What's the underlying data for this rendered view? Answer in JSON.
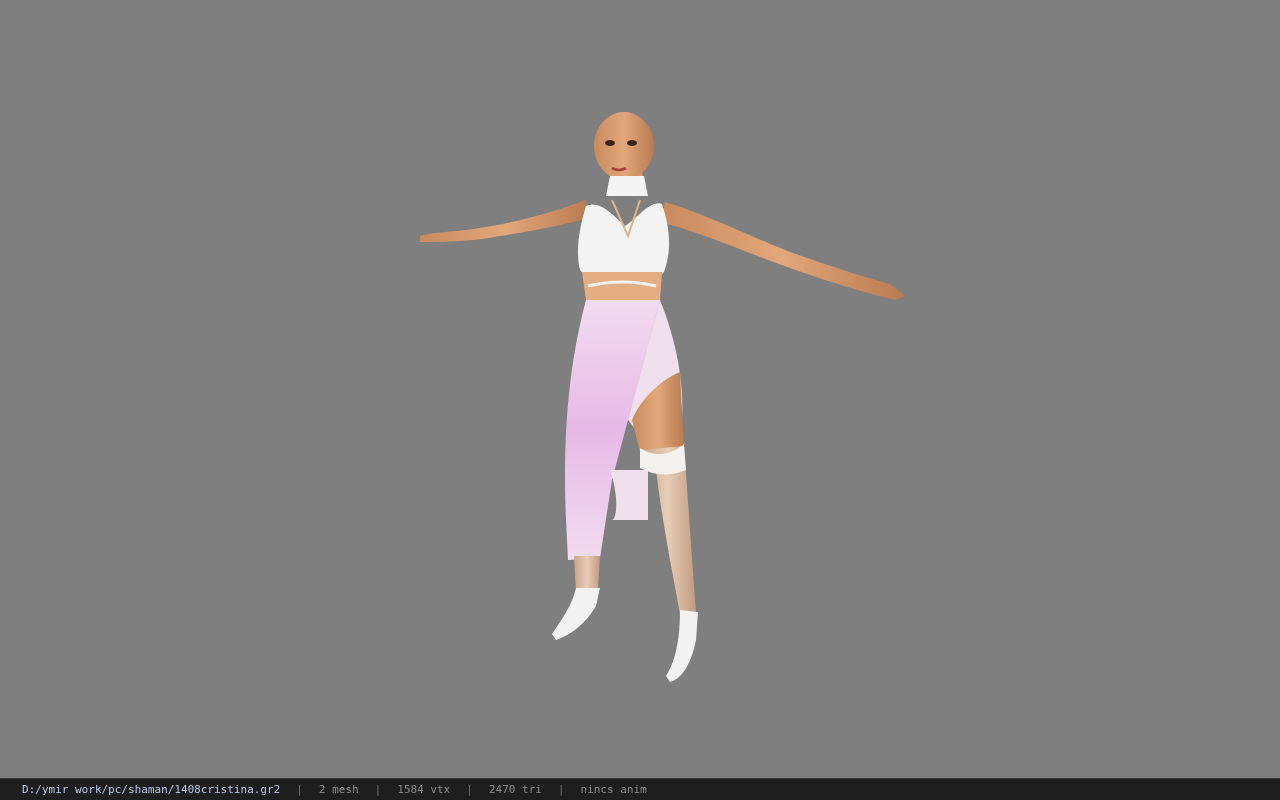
{
  "viewport": {
    "background": "#7f7f7f",
    "model_name": "female-character-model"
  },
  "statusbar": {
    "file_path": "D:/ymir work/pc/shaman/1408cristina.gr2",
    "separator": "|",
    "mesh_count": "2 mesh",
    "vertex_count": "1584 vtx",
    "triangle_count": "2470 tri",
    "anim_status": "nincs anim"
  },
  "colors": {
    "statusbar_bg": "#1e1e1e",
    "path_text": "#b9c7e6",
    "info_text": "#8a8a8a"
  }
}
